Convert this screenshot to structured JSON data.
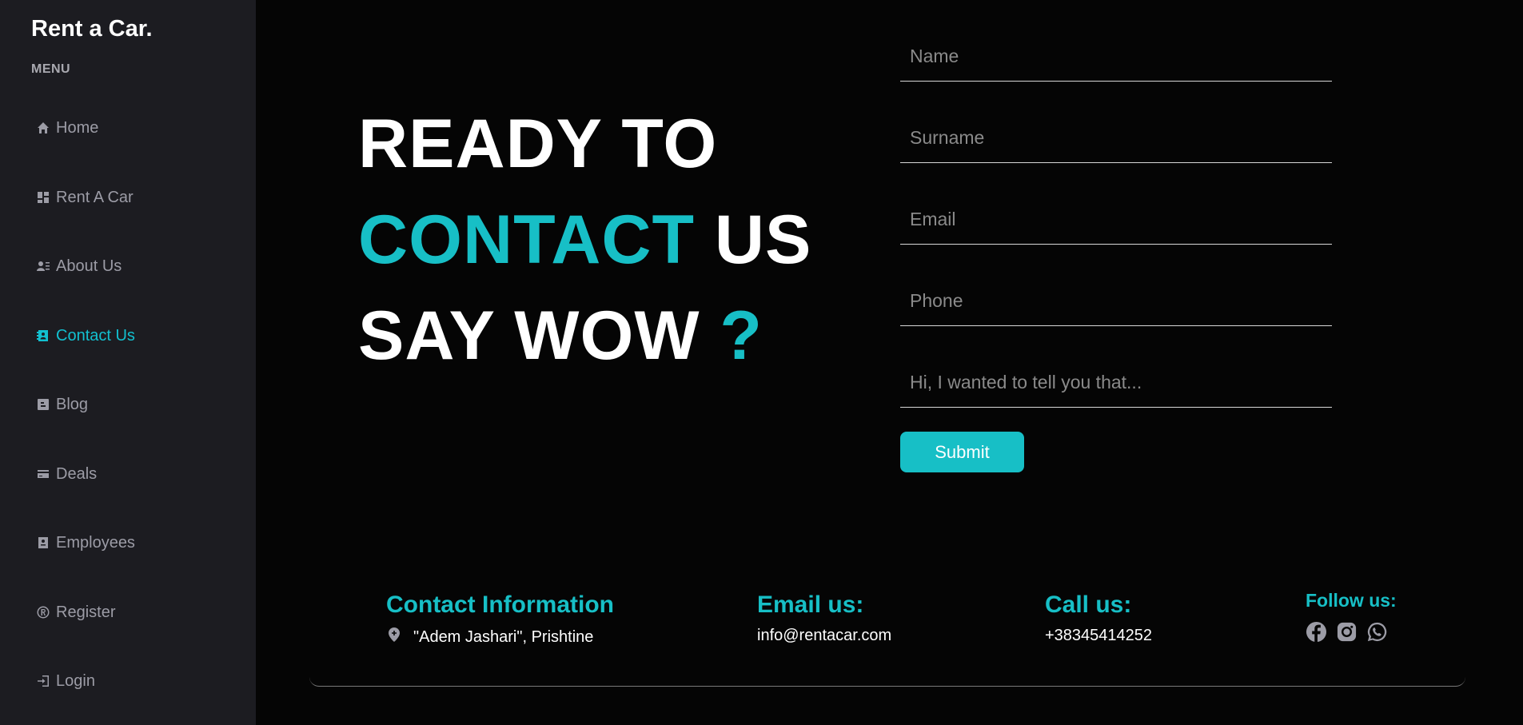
{
  "sidebar": {
    "brand": "Rent a Car.",
    "menu_label": "MENU",
    "items": [
      {
        "label": "Home",
        "icon": "home-icon"
      },
      {
        "label": "Rent A Car",
        "icon": "dashboard-icon"
      },
      {
        "label": "About Us",
        "icon": "contact-card-icon"
      },
      {
        "label": "Contact Us",
        "icon": "address-book-icon",
        "active": true
      },
      {
        "label": "Blog",
        "icon": "blog-icon"
      },
      {
        "label": "Deals",
        "icon": "credit-card-icon"
      },
      {
        "label": "Employees",
        "icon": "badge-icon"
      },
      {
        "label": "Register",
        "icon": "registered-icon"
      },
      {
        "label": "Login",
        "icon": "login-icon"
      }
    ]
  },
  "hero": {
    "line1": "READY TO",
    "line2_accent": "CONTACT",
    "line2_rest": "US",
    "line3": "SAY WOW",
    "line3_accent": "?"
  },
  "form": {
    "name_placeholder": "Name",
    "surname_placeholder": "Surname",
    "email_placeholder": "Email",
    "phone_placeholder": "Phone",
    "message_placeholder": "Hi, I wanted to tell you that...",
    "submit_label": "Submit"
  },
  "footer": {
    "contact_heading": "Contact Information",
    "address": "\"Adem Jashari\", Prishtine",
    "email_heading": "Email us:",
    "email": "info@rentacar.com",
    "call_heading": "Call us:",
    "phone": "+38345414252",
    "follow_heading": "Follow us:",
    "socials": [
      "facebook-icon",
      "instagram-icon",
      "whatsapp-icon"
    ]
  },
  "colors": {
    "accent": "#17bfc6",
    "sidebar_bg": "#1c1c21",
    "page_bg": "#050505",
    "nav_text": "#9c9ca6"
  }
}
